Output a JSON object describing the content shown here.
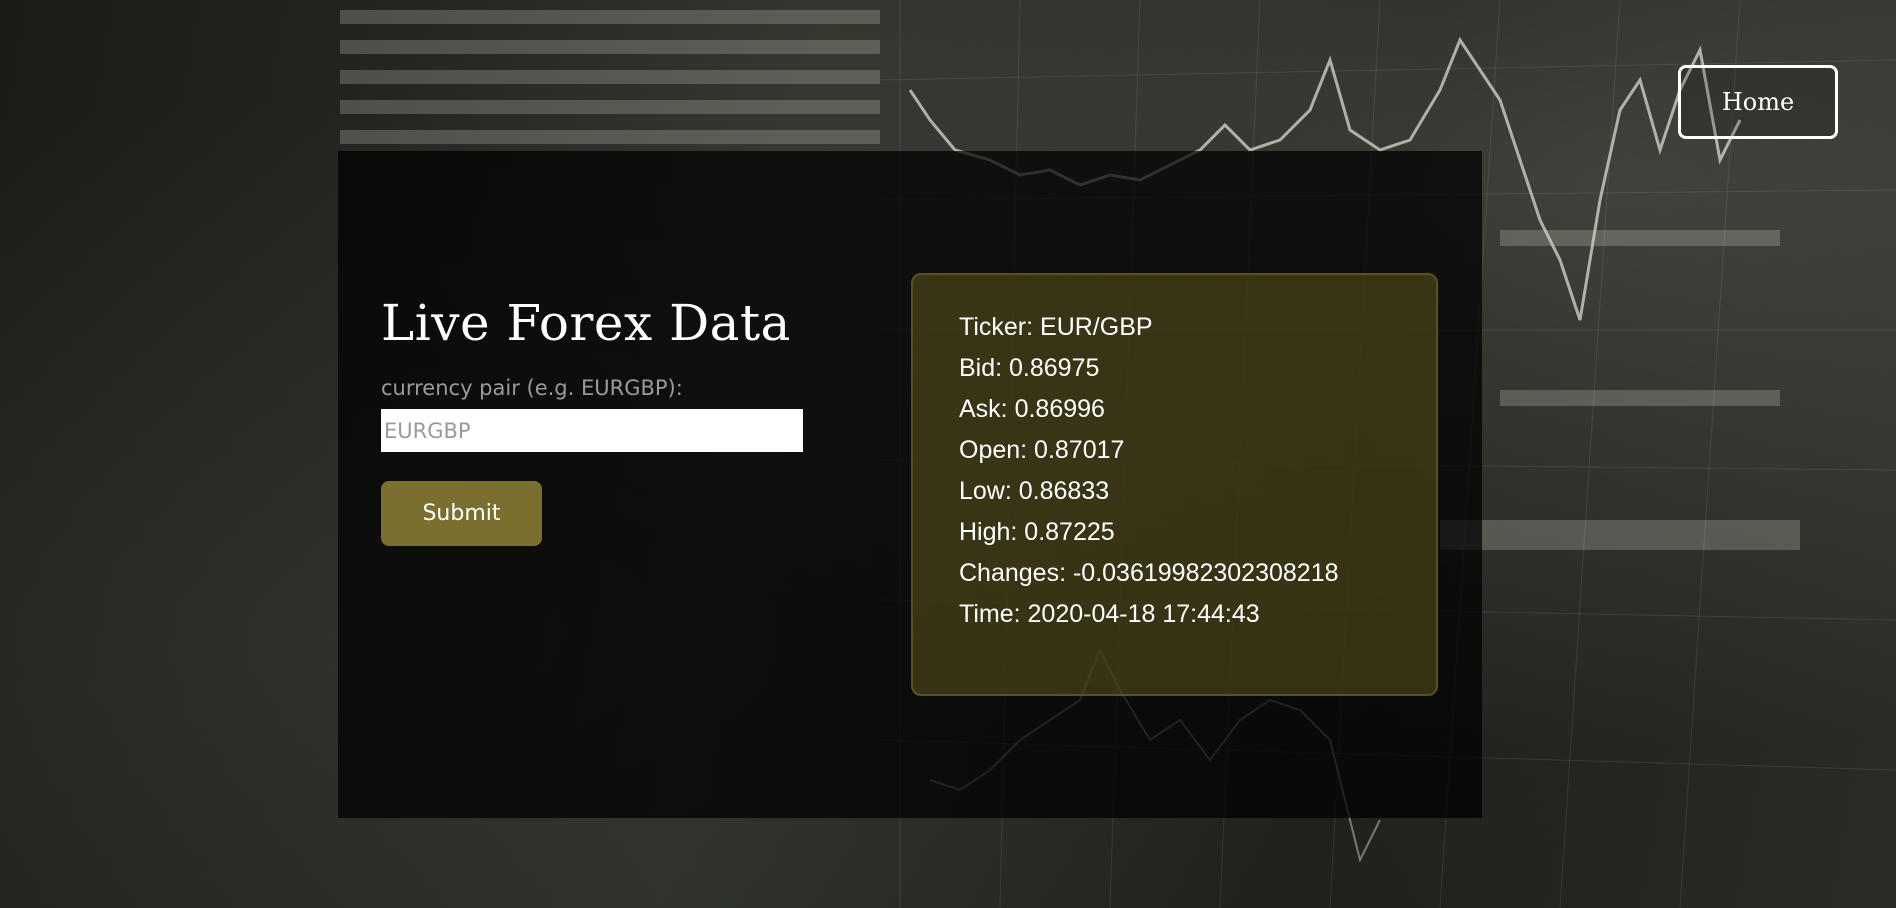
{
  "nav": {
    "home_label": "Home"
  },
  "form": {
    "title": "Live Forex Data",
    "label": "currency pair (e.g. EURGBP):",
    "placeholder": "EURGBP",
    "value": "",
    "submit_label": "Submit"
  },
  "quote": {
    "rows": [
      "Ticker: EUR/GBP",
      "Bid: 0.86975",
      "Ask: 0.86996",
      "Open: 0.87017",
      "Low: 0.86833",
      "High: 0.87225",
      "Changes: -0.03619982302308218",
      "Time: 2020-04-18 17:44:43"
    ]
  },
  "colors": {
    "accent": "#7b6f30",
    "card_background": "#5c541e",
    "panel_background": "#000000"
  }
}
